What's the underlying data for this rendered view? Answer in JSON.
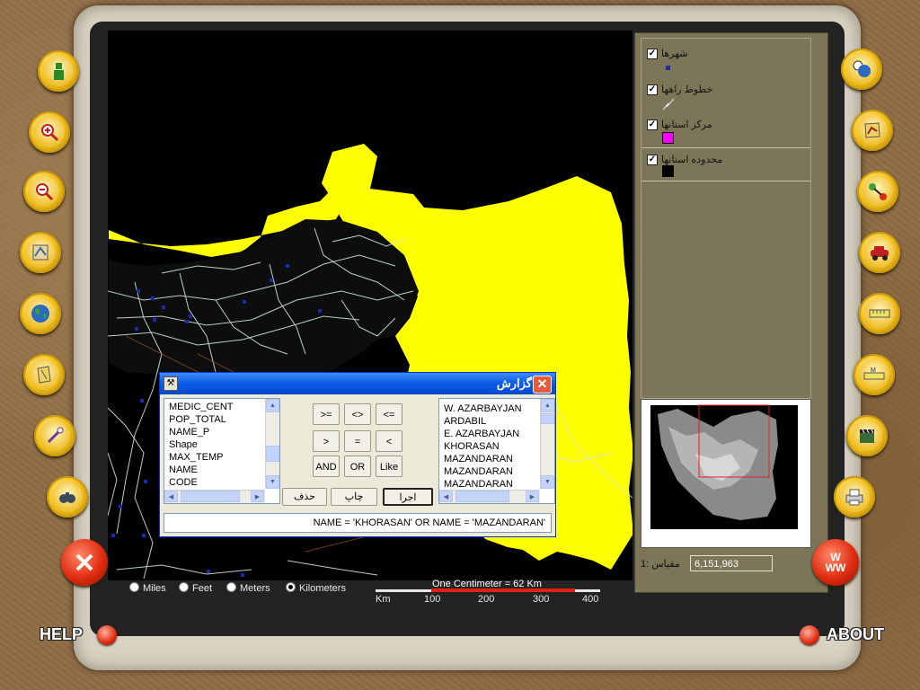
{
  "app": {
    "help_label": "HELP",
    "about_label": "ABOUT",
    "www_label": "W\nWW"
  },
  "left_toolbar": [
    {
      "name": "info-tool",
      "icon": "info-person-icon"
    },
    {
      "name": "zoom-in-tool",
      "icon": "zoom-in-icon"
    },
    {
      "name": "zoom-out-tool",
      "icon": "zoom-out-icon"
    },
    {
      "name": "pan-tool",
      "icon": "map-pan-icon"
    },
    {
      "name": "globe-tool",
      "icon": "globe-icon"
    },
    {
      "name": "measure-map-tool",
      "icon": "map-measure-icon"
    },
    {
      "name": "wand-tool",
      "icon": "magic-wand-icon"
    },
    {
      "name": "binoculars-tool",
      "icon": "binoculars-icon"
    }
  ],
  "right_toolbar": [
    {
      "name": "numbered-query-tool",
      "icon": "numbers-icon"
    },
    {
      "name": "route-map-tool",
      "icon": "route-map-icon"
    },
    {
      "name": "path-tool",
      "icon": "path-icon"
    },
    {
      "name": "car-tool",
      "icon": "car-icon"
    },
    {
      "name": "ruler-tool",
      "icon": "ruler-icon"
    },
    {
      "name": "scale-ruler-tool",
      "icon": "scale-ruler-icon"
    },
    {
      "name": "movie-tool",
      "icon": "clapperboard-icon"
    },
    {
      "name": "print-tool",
      "icon": "printer-icon"
    }
  ],
  "layers": [
    {
      "label": "شهرها",
      "checked": true,
      "symbol": "blue-square",
      "color": "#1a2aa8"
    },
    {
      "label": "خطوط راهها",
      "checked": true,
      "symbol": "road-line",
      "color": "#d8d8d8"
    },
    {
      "label": "مرکز استانها",
      "checked": true,
      "symbol": "magenta-square",
      "color": "#ff00ff"
    },
    {
      "label": "محدوده استانها",
      "checked": true,
      "symbol": "black-square",
      "color": "#000000"
    }
  ],
  "scale": {
    "label": "مقیاس :1",
    "value": "6,151,963"
  },
  "units": [
    {
      "label": "Miles",
      "selected": false
    },
    {
      "label": "Feet",
      "selected": false
    },
    {
      "label": "Meters",
      "selected": false
    },
    {
      "label": "Kilometers",
      "selected": true
    }
  ],
  "scalebar": {
    "caption": "One Centimeter = 62 Km",
    "unit": "Km",
    "ticks": [
      "100",
      "200",
      "300",
      "400"
    ]
  },
  "dialog": {
    "title": "گزارش",
    "fields": [
      "MEDIC_CENT",
      "POP_TOTAL",
      "NAME_P",
      "Shape",
      "MAX_TEMP",
      "NAME",
      "CODE"
    ],
    "values": [
      "W. AZARBAYJAN",
      "ARDABIL",
      "E. AZARBAYJAN",
      "KHORASAN",
      "MAZANDARAN",
      "MAZANDARAN",
      "MAZANDARAN"
    ],
    "operators": [
      ">=",
      "<>",
      "<=",
      ">",
      "=",
      "<",
      "AND",
      "OR",
      "Like"
    ],
    "run_label": "اجرا",
    "print_label": "چاپ",
    "delete_label": "حذف",
    "query": "NAME = 'KHORASAN' OR NAME = 'MAZANDARAN'"
  },
  "colors": {
    "selected_province": "#ffff00",
    "map_background": "#000000",
    "panel": "#7c7558",
    "dialog_title": "#0a5ae6"
  }
}
